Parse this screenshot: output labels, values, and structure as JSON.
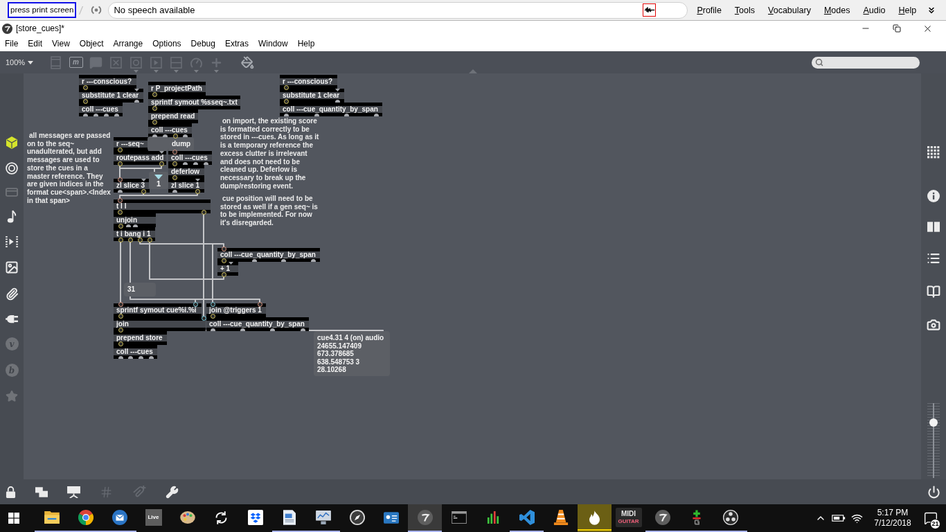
{
  "speech_bar": {
    "status": "press print screen",
    "field_value": "No speech available",
    "menu": [
      "Profile",
      "Tools",
      "Vocabulary",
      "Modes",
      "Audio",
      "Help"
    ]
  },
  "window": {
    "title": "[store_cues]*"
  },
  "menu_bar": [
    "File",
    "Edit",
    "View",
    "Object",
    "Arrange",
    "Options",
    "Debug",
    "Extras",
    "Window",
    "Help"
  ],
  "toolbar": {
    "zoom": "100%",
    "tools": [
      {
        "kind": "panel",
        "disabled": true
      },
      {
        "kind": "message",
        "text": "m",
        "disabled": true
      },
      {
        "kind": "comment",
        "disabled": true
      },
      {
        "kind": "toggle",
        "disabled": true
      },
      {
        "kind": "button",
        "disabled": true
      },
      {
        "kind": "play",
        "disabled": true
      },
      {
        "kind": "slider",
        "disabled": true
      },
      {
        "kind": "dial",
        "disabled": true
      },
      {
        "kind": "plus",
        "disabled": true
      },
      {
        "kind": "bucket",
        "disabled": false
      }
    ]
  },
  "left_sidebar": [
    {
      "kind": "cube",
      "selected": true,
      "disabled": false
    },
    {
      "kind": "target",
      "selected": false,
      "disabled": false
    },
    {
      "kind": "panel",
      "selected": false,
      "disabled": true
    },
    {
      "kind": "note",
      "selected": false,
      "disabled": false
    },
    {
      "kind": "frames",
      "selected": false,
      "disabled": false
    },
    {
      "kind": "image",
      "selected": false,
      "disabled": false
    },
    {
      "kind": "clip",
      "selected": false,
      "disabled": false
    },
    {
      "kind": "plug",
      "selected": false,
      "disabled": false
    },
    {
      "kind": "letter",
      "text": "v",
      "selected": false,
      "disabled": true
    },
    {
      "kind": "letter",
      "text": "b",
      "selected": false,
      "disabled": true
    },
    {
      "kind": "star",
      "selected": false,
      "disabled": true
    }
  ],
  "patcher": {
    "boxes": [
      {
        "kind": "object",
        "text": "r ---conscious?"
      },
      {
        "kind": "object",
        "text": "substitute 1 clear"
      },
      {
        "kind": "object",
        "text": "coll ---cues"
      },
      {
        "kind": "object",
        "text": "r P_projectPath"
      },
      {
        "kind": "object",
        "text": "sprintf symout %sseq~.txt"
      },
      {
        "kind": "object",
        "text": "prepend read"
      },
      {
        "kind": "object",
        "text": "coll ---cues"
      },
      {
        "kind": "object",
        "text": "r ---conscious?"
      },
      {
        "kind": "object",
        "text": "substitute 1 clear"
      },
      {
        "kind": "object",
        "text": "coll ---cue_quantity_by_span"
      },
      {
        "kind": "comment",
        "text": "on import, the existing score is formatted correctly to be stored in ---cues. As long as it is a temporary reference the excess clutter is irrelevant and does not need to be cleaned up. Deferlow is necessary to break up the dump/restoring event."
      },
      {
        "kind": "comment",
        "text": "all messages are passed on to the seq~ unadulterated, but add messages are used to store the cues in a master reference. They are given indices in the format cue<span>.<Index in that span>"
      },
      {
        "kind": "object",
        "text": "r ---seq~"
      },
      {
        "kind": "message"
      },
      {
        "kind": "message",
        "text": "dump"
      },
      {
        "kind": "object",
        "text": "routepass add"
      },
      {
        "kind": "object",
        "text": "coll ---cues"
      },
      {
        "kind": "object",
        "text": "deferlow"
      },
      {
        "kind": "object",
        "text": "zl slice 3"
      },
      {
        "kind": "number",
        "text": "1"
      },
      {
        "kind": "object",
        "text": "zl slice 1"
      },
      {
        "kind": "comment",
        "text": "cue position will need to be stored as well if a gen seq~ is to be implemented. For now it's disregarded."
      },
      {
        "kind": "object",
        "text": "t l l"
      },
      {
        "kind": "object",
        "text": "unjoin"
      },
      {
        "kind": "object",
        "text": "t i bang i 1"
      },
      {
        "kind": "object",
        "text": "coll ---cue_quantity_by_span"
      },
      {
        "kind": "object",
        "text": "+ 1"
      },
      {
        "kind": "message",
        "text": "31"
      },
      {
        "kind": "object",
        "text": "sprintf symout cue%i.%i"
      },
      {
        "kind": "object",
        "text": "join @triggers 1"
      },
      {
        "kind": "object",
        "text": "join"
      },
      {
        "kind": "object",
        "text": "coll ---cue_quantity_by_span"
      },
      {
        "kind": "object",
        "text": "prepend store"
      },
      {
        "kind": "object",
        "text": "coll ---cues"
      },
      {
        "kind": "message",
        "text": "cue4.31 4 (on) audio 24655.147409 673.378685 638.548753 3 28.10268"
      }
    ]
  },
  "right_sidebar": {
    "tools": [
      {
        "kind": "dots"
      },
      {
        "kind": "info"
      },
      {
        "kind": "panes"
      },
      {
        "kind": "list"
      },
      {
        "kind": "book"
      },
      {
        "kind": "camera"
      }
    ],
    "volume": {
      "level": 0.77
    }
  },
  "bottom_bar": [
    {
      "kind": "lock",
      "disabled": false
    },
    {
      "kind": "windows",
      "disabled": false
    },
    {
      "kind": "presentation",
      "disabled": false
    },
    {
      "kind": "grid",
      "disabled": true
    },
    {
      "kind": "clip_add",
      "disabled": true
    },
    {
      "kind": "wrench",
      "disabled": false
    },
    {
      "kind": "power",
      "disabled": false
    }
  ],
  "taskbar": {
    "apps": [
      {
        "kind": "folder",
        "running": true,
        "active": false,
        "flashing": false
      },
      {
        "kind": "browser",
        "running": true,
        "active": false,
        "flashing": false
      },
      {
        "kind": "mail",
        "running": true,
        "active": false,
        "flashing": false
      },
      {
        "kind": "tile",
        "label": "Live",
        "running": false,
        "active": false,
        "flashing": false
      },
      {
        "kind": "palette",
        "running": false,
        "active": false,
        "flashing": false
      },
      {
        "kind": "sync",
        "running": false,
        "active": false,
        "flashing": false
      },
      {
        "kind": "box",
        "running": false,
        "active": false,
        "flashing": false
      },
      {
        "kind": "document",
        "running": true,
        "active": false,
        "flashing": false
      },
      {
        "kind": "monitor",
        "running": true,
        "active": false,
        "flashing": false
      },
      {
        "kind": "compass",
        "running": false,
        "active": false,
        "flashing": false
      },
      {
        "kind": "card",
        "running": false,
        "active": false,
        "flashing": false
      },
      {
        "kind": "logo",
        "running": true,
        "active": true,
        "flashing": false
      },
      {
        "kind": "terminal",
        "running": false,
        "active": false,
        "flashing": false
      },
      {
        "kind": "bars",
        "running": false,
        "active": false,
        "flashing": false
      },
      {
        "kind": "editor",
        "running": true,
        "active": false,
        "flashing": false
      },
      {
        "kind": "cone",
        "running": false,
        "active": false,
        "flashing": false
      },
      {
        "kind": "flame",
        "running": false,
        "active": false,
        "flashing": true
      },
      {
        "kind": "darktile",
        "label": "MIDI",
        "sublabel": "GUITAR",
        "running": false,
        "active": false,
        "flashing": false
      },
      {
        "kind": "logo",
        "running": true,
        "active": false,
        "flashing": false
      },
      {
        "kind": "plus",
        "running": true,
        "active": false,
        "flashing": false
      },
      {
        "kind": "aperture",
        "running": true,
        "active": false,
        "flashing": false
      }
    ],
    "time": "5:17 PM",
    "date": "7/12/2018",
    "notification_count": "21"
  }
}
